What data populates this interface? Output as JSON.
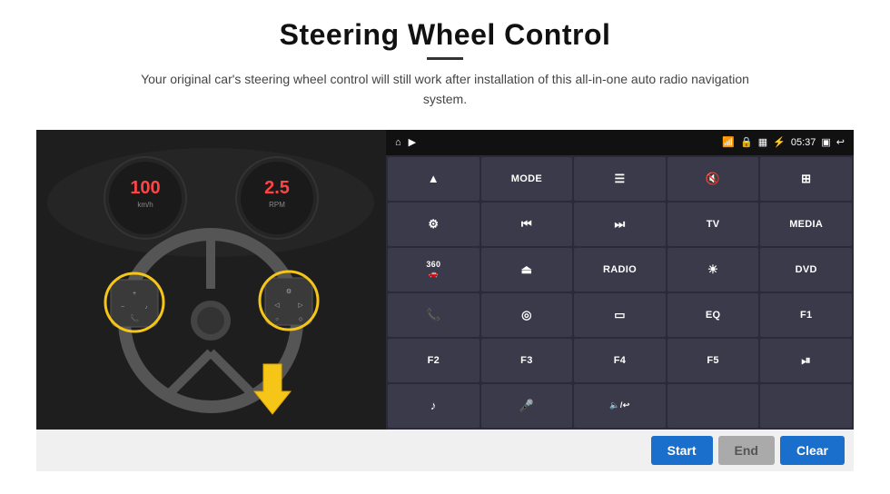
{
  "page": {
    "title": "Steering Wheel Control",
    "subtitle": "Your original car's steering wheel control will still work after installation of this all-in-one auto radio navigation system."
  },
  "statusBar": {
    "time": "05:37",
    "wifiIcon": "wifi",
    "lockIcon": "lock",
    "simIcon": "sim",
    "bluetoothIcon": "bluetooth",
    "windowIcon": "window",
    "backIcon": "back"
  },
  "buttons": [
    {
      "id": "b1",
      "label": "▲",
      "icon": true,
      "row": 1,
      "col": 1
    },
    {
      "id": "b2",
      "label": "MODE",
      "icon": false,
      "row": 1,
      "col": 2
    },
    {
      "id": "b3",
      "label": "≡",
      "icon": true,
      "row": 1,
      "col": 3
    },
    {
      "id": "b4",
      "label": "🔇",
      "icon": true,
      "row": 1,
      "col": 4
    },
    {
      "id": "b5",
      "label": "⊞",
      "icon": true,
      "row": 1,
      "col": 5
    },
    {
      "id": "b6",
      "label": "⚙",
      "icon": true,
      "row": 2,
      "col": 1
    },
    {
      "id": "b7",
      "label": "⏮",
      "icon": true,
      "row": 2,
      "col": 2
    },
    {
      "id": "b8",
      "label": "⏭",
      "icon": true,
      "row": 2,
      "col": 3
    },
    {
      "id": "b9",
      "label": "TV",
      "icon": false,
      "row": 2,
      "col": 4
    },
    {
      "id": "b10",
      "label": "MEDIA",
      "icon": false,
      "row": 2,
      "col": 5
    },
    {
      "id": "b11",
      "label": "360",
      "icon": false,
      "row": 3,
      "col": 1
    },
    {
      "id": "b12",
      "label": "⏏",
      "icon": true,
      "row": 3,
      "col": 2
    },
    {
      "id": "b13",
      "label": "RADIO",
      "icon": false,
      "row": 3,
      "col": 3
    },
    {
      "id": "b14",
      "label": "☀",
      "icon": true,
      "row": 3,
      "col": 4
    },
    {
      "id": "b15",
      "label": "DVD",
      "icon": false,
      "row": 3,
      "col": 5
    },
    {
      "id": "b16",
      "label": "📞",
      "icon": true,
      "row": 4,
      "col": 1
    },
    {
      "id": "b17",
      "label": "◎",
      "icon": true,
      "row": 4,
      "col": 2
    },
    {
      "id": "b18",
      "label": "▭",
      "icon": true,
      "row": 4,
      "col": 3
    },
    {
      "id": "b19",
      "label": "EQ",
      "icon": false,
      "row": 4,
      "col": 4
    },
    {
      "id": "b20",
      "label": "F1",
      "icon": false,
      "row": 4,
      "col": 5
    },
    {
      "id": "b21",
      "label": "F2",
      "icon": false,
      "row": 5,
      "col": 1
    },
    {
      "id": "b22",
      "label": "F3",
      "icon": false,
      "row": 5,
      "col": 2
    },
    {
      "id": "b23",
      "label": "F4",
      "icon": false,
      "row": 5,
      "col": 3
    },
    {
      "id": "b24",
      "label": "F5",
      "icon": false,
      "row": 5,
      "col": 4
    },
    {
      "id": "b25",
      "label": "⏯",
      "icon": true,
      "row": 5,
      "col": 5
    },
    {
      "id": "b26",
      "label": "♪",
      "icon": true,
      "row": 6,
      "col": 1
    },
    {
      "id": "b27",
      "label": "🎤",
      "icon": true,
      "row": 6,
      "col": 2
    },
    {
      "id": "b28",
      "label": "🔈/↩",
      "icon": true,
      "row": 6,
      "col": 3
    },
    {
      "id": "b29",
      "label": "",
      "icon": false,
      "row": 6,
      "col": 4
    },
    {
      "id": "b30",
      "label": "",
      "icon": false,
      "row": 6,
      "col": 5
    }
  ],
  "bottomBar": {
    "startLabel": "Start",
    "endLabel": "End",
    "clearLabel": "Clear"
  }
}
